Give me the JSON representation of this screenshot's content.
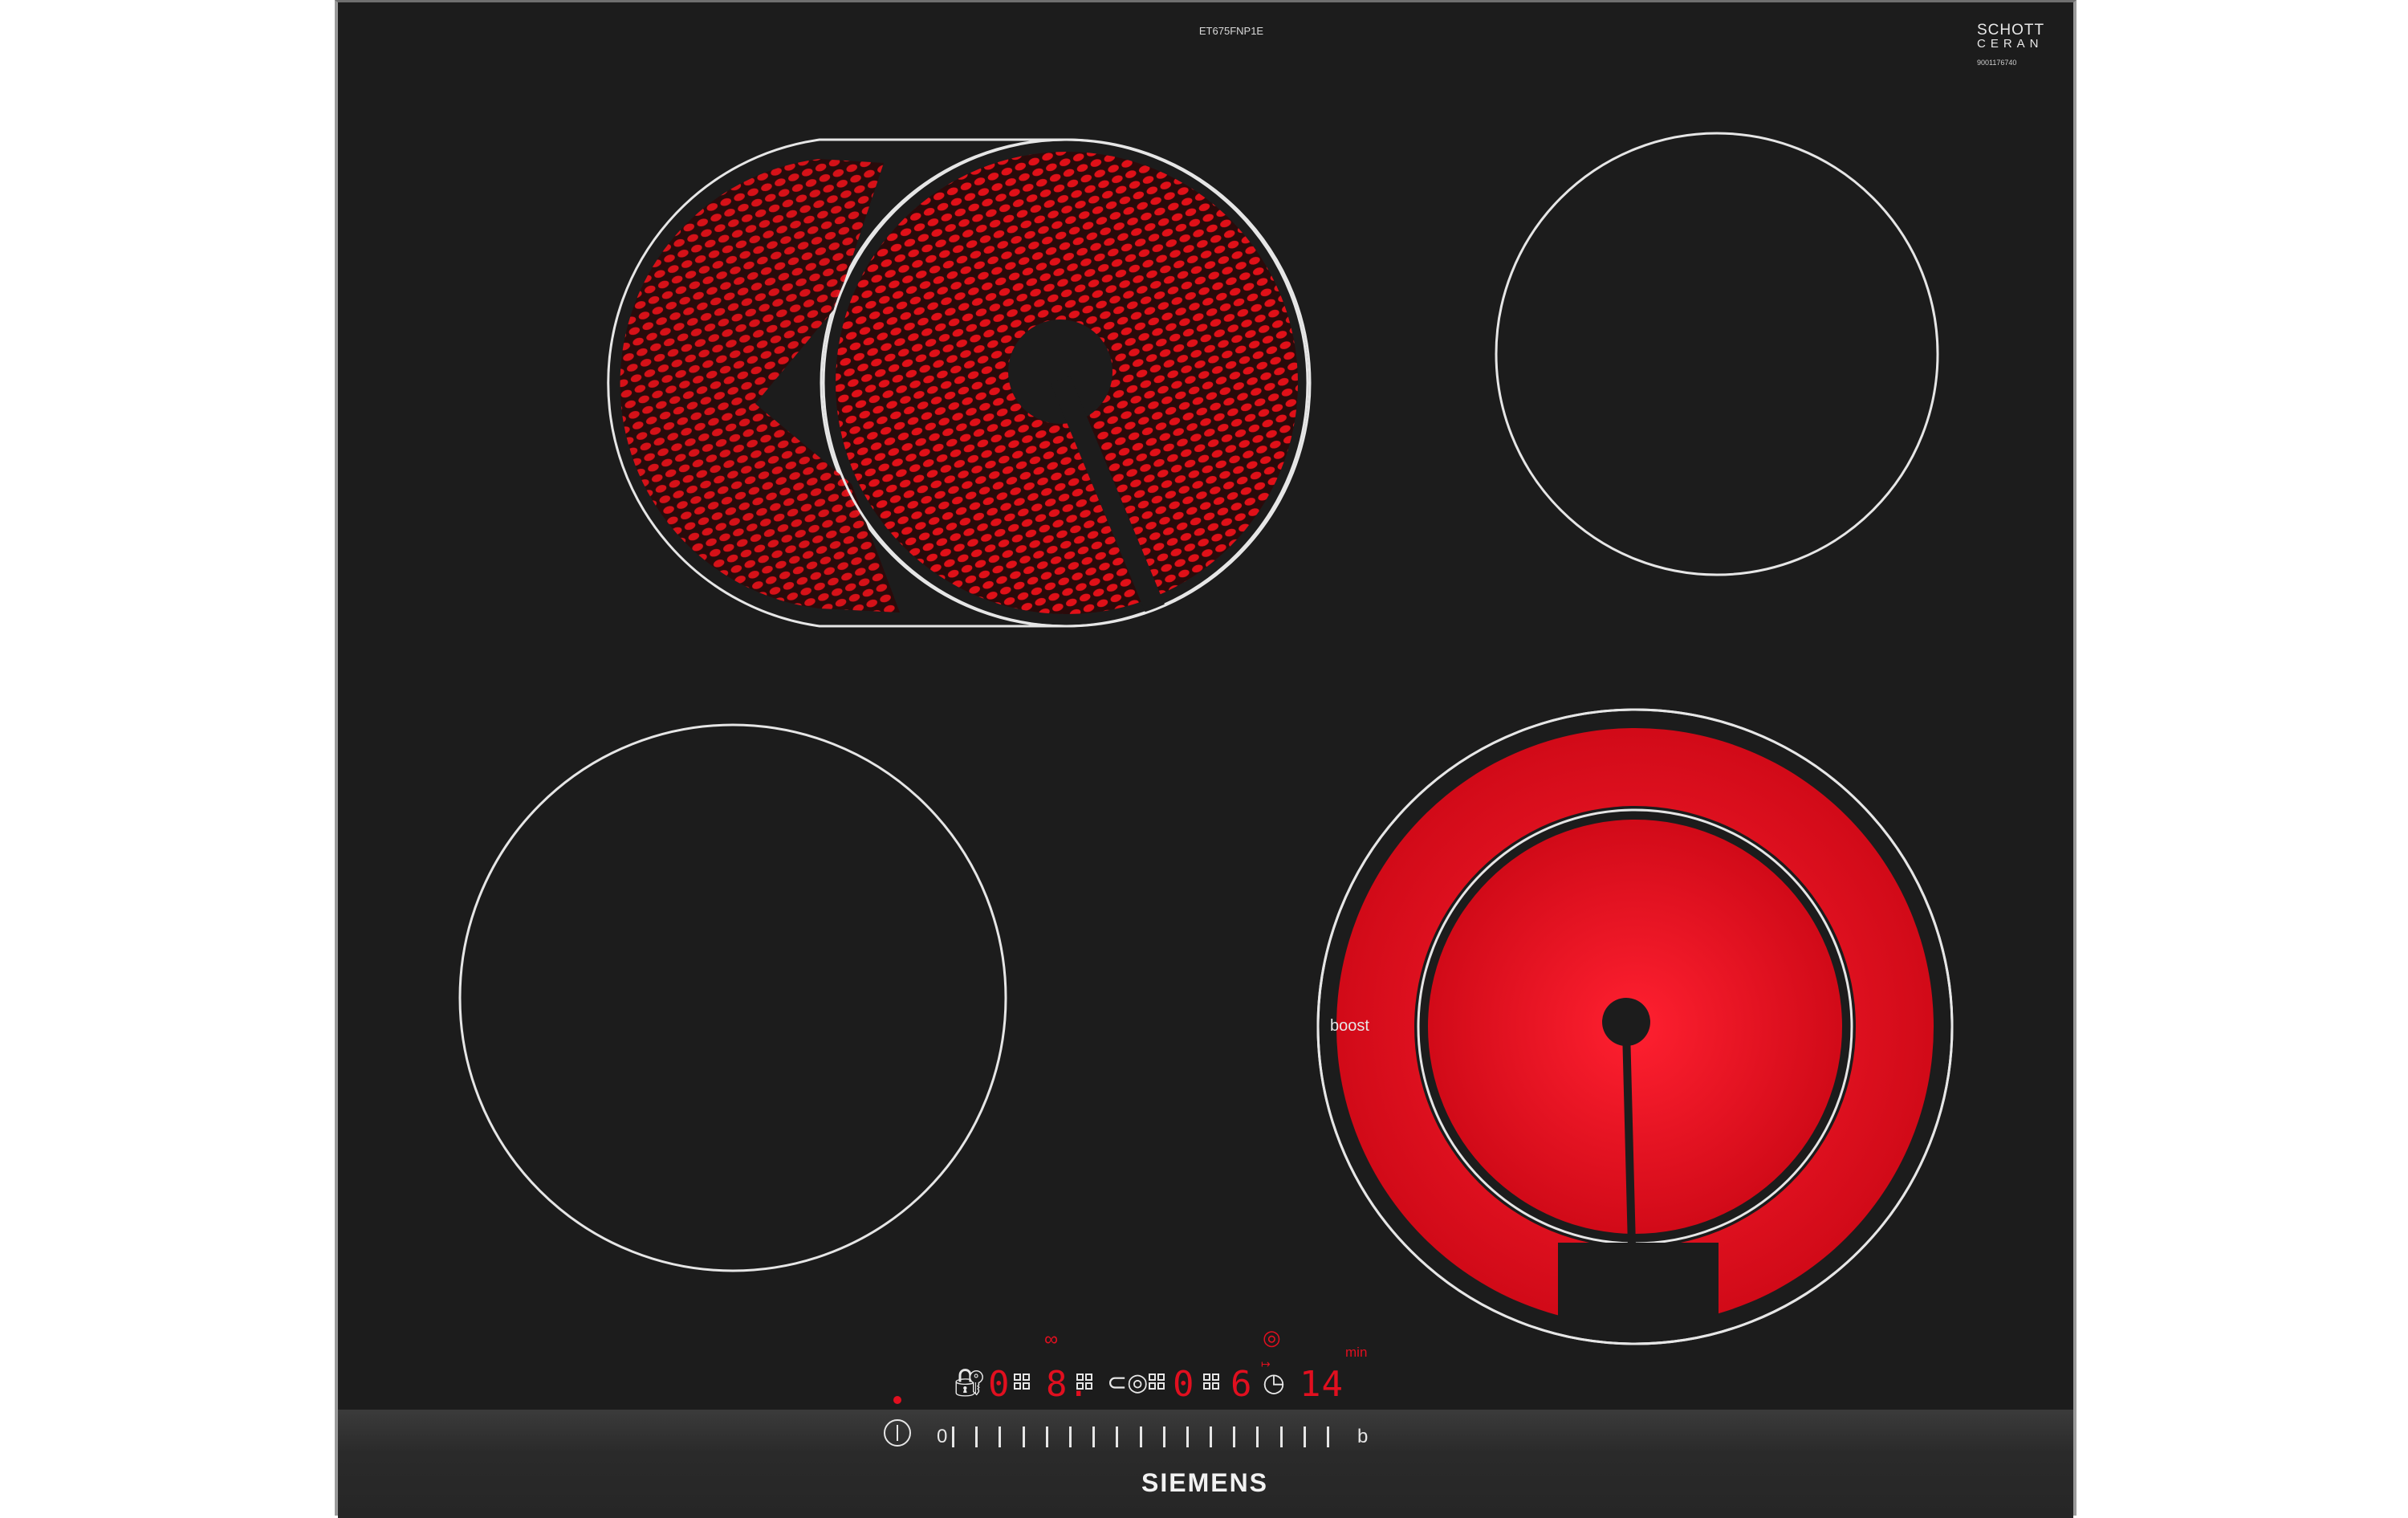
{
  "product": {
    "model": "ET675FNP1E",
    "brand": "SIEMENS",
    "glass_maker_line1": "SCHOTT",
    "glass_maker_line2": "CERAN",
    "serial": "9001176740",
    "surface_color": "#1c1c1c",
    "heat_color": "#e10f1f"
  },
  "zones": [
    {
      "name": "front-left zone",
      "active": true,
      "type": "dual extended"
    },
    {
      "name": "rear-right zone",
      "active": false
    },
    {
      "name": "rear-left zone",
      "active": false
    },
    {
      "name": "front-right zone",
      "active": true,
      "type": "dual ring"
    }
  ],
  "labels": {
    "boost": "boost"
  },
  "display": {
    "zone1_level": "0",
    "zone2_level": "8.",
    "zone3_level": "0",
    "zone4_level": "6",
    "timer_value": "14",
    "timer_unit": "min"
  },
  "slider": {
    "min_label": "0",
    "boost_label": "b",
    "ticks": 17
  },
  "icons": {
    "power": "power-icon",
    "lock": "child-lock-icon",
    "link": "dual-zone-link-icon",
    "extend": "zone-extension-icon",
    "timer": "clock-icon"
  }
}
